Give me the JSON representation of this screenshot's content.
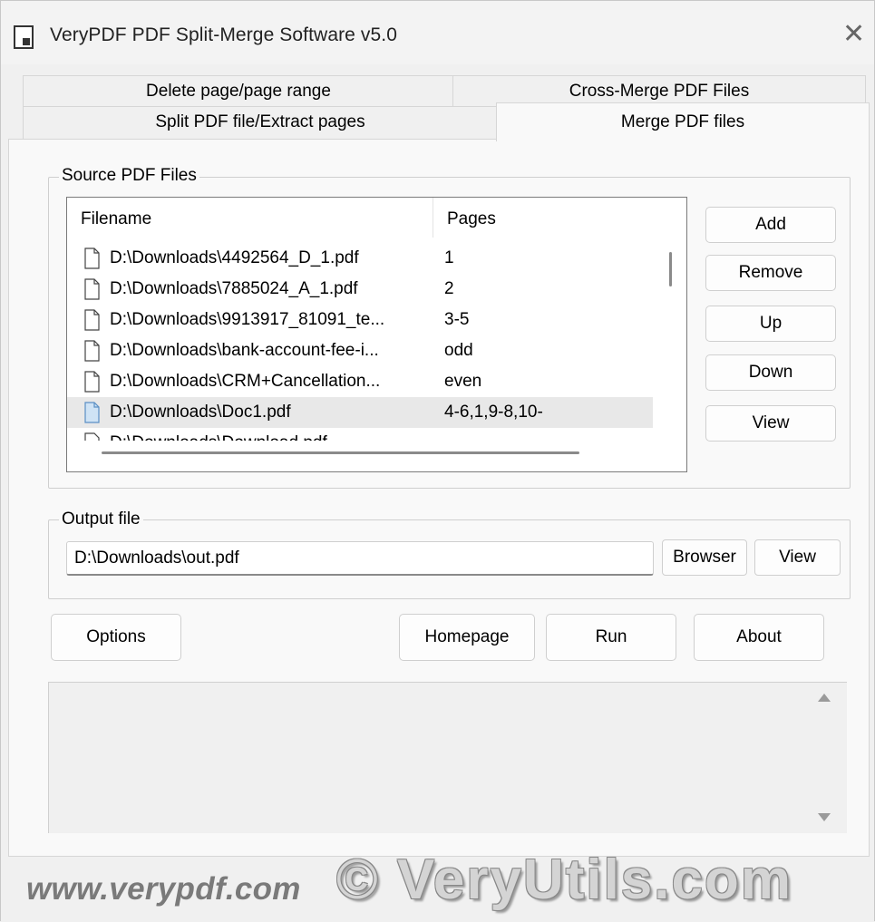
{
  "window": {
    "title": "VeryPDF PDF Split-Merge Software v5.0",
    "close_glyph": "✕"
  },
  "tabs": [
    {
      "label": "Delete page/page range"
    },
    {
      "label": "Cross-Merge PDF Files"
    },
    {
      "label": "Split PDF file/Extract pages"
    },
    {
      "label": "Merge PDF files",
      "active": true
    }
  ],
  "source_group": {
    "label": "Source PDF Files",
    "columns": [
      "Filename",
      "Pages"
    ],
    "rows": [
      {
        "filename": "D:\\Downloads\\4492564_D_1.pdf",
        "pages": "1"
      },
      {
        "filename": "D:\\Downloads\\7885024_A_1.pdf",
        "pages": "2"
      },
      {
        "filename": "D:\\Downloads\\9913917_81091_te...",
        "pages": "3-5"
      },
      {
        "filename": "D:\\Downloads\\bank-account-fee-i...",
        "pages": "odd"
      },
      {
        "filename": "D:\\Downloads\\CRM+Cancellation...",
        "pages": "even"
      },
      {
        "filename": "D:\\Downloads\\Doc1.pdf",
        "pages": "4-6,1,9-8,10-",
        "selected": true
      },
      {
        "filename": "D:\\Downloads\\Download.pdf",
        "pages": ""
      }
    ],
    "buttons": {
      "add": "Add",
      "remove": "Remove",
      "up": "Up",
      "down": "Down",
      "view": "View"
    }
  },
  "output_group": {
    "label": "Output file",
    "value": "D:\\Downloads\\out.pdf",
    "browser_button": "Browser",
    "view_button": "View"
  },
  "bottom_buttons": {
    "options": "Options",
    "homepage": "Homepage",
    "run": "Run",
    "about": "About"
  },
  "log": {
    "text": ""
  },
  "watermark": {
    "url": "www.verypdf.com",
    "brand": "© VeryUtils.com"
  },
  "colors": {
    "selected_row": "#e8e8e8",
    "selected_icon": "#cfe3f5",
    "window_bg": "#f0f0f0"
  }
}
